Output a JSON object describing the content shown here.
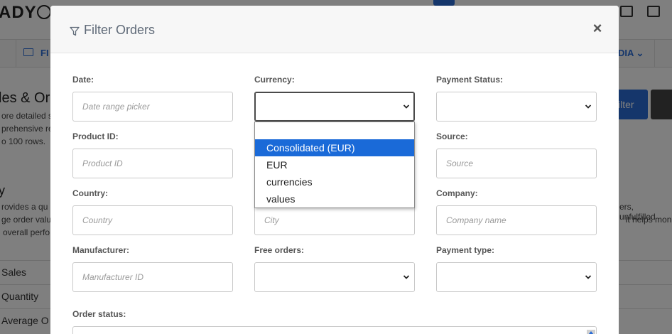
{
  "background": {
    "logo_text": "ADY",
    "nav_left_label": "FI",
    "nav_right_label": "DIA",
    "page_heading": "les & Or",
    "page_lines": [
      "ore detailed s",
      "prehensive re",
      "o 100 rows."
    ],
    "filter_button_label": "ilter",
    "section_heading": "y",
    "section_lines": [
      "rovides a qu",
      "ge order valu",
      "overall perfo"
    ],
    "section_right_lines": [
      "ers, unfulfilled",
      "It helps mon"
    ],
    "rows": [
      "Sales",
      "Quantity",
      "Average O"
    ],
    "row_right_text": "("
  },
  "modal": {
    "title": "Filter Orders",
    "close_label": "×",
    "fields": {
      "date": {
        "label": "Date:",
        "placeholder": "Date range picker"
      },
      "currency": {
        "label": "Currency:",
        "value": ""
      },
      "payment_status": {
        "label": "Payment Status:",
        "value": ""
      },
      "product_id": {
        "label": "Product ID:",
        "placeholder": "Product ID"
      },
      "source": {
        "label": "Source:",
        "placeholder": "Source"
      },
      "country": {
        "label": "Country:",
        "placeholder": "Country"
      },
      "city": {
        "placeholder": "City"
      },
      "company": {
        "label": "Company:",
        "placeholder": "Company name"
      },
      "manufacturer": {
        "label": "Manufacturer:",
        "placeholder": "Manufacturer ID"
      },
      "free_orders": {
        "label": "Free orders:",
        "value": ""
      },
      "payment_type": {
        "label": "Payment type:",
        "value": ""
      },
      "order_status": {
        "label": "Order status:"
      }
    },
    "currency_dropdown": {
      "options": [
        "",
        "Consolidated (EUR)",
        "EUR",
        "currencies",
        "values"
      ],
      "highlighted": "Consolidated (EUR)"
    }
  },
  "colors": {
    "accent": "#1a6ad8",
    "overlay": "rgba(0,0,0,0.5)"
  },
  "icons": [
    "funnel-icon",
    "close-icon",
    "chevron-down-icon",
    "folder-icon"
  ]
}
